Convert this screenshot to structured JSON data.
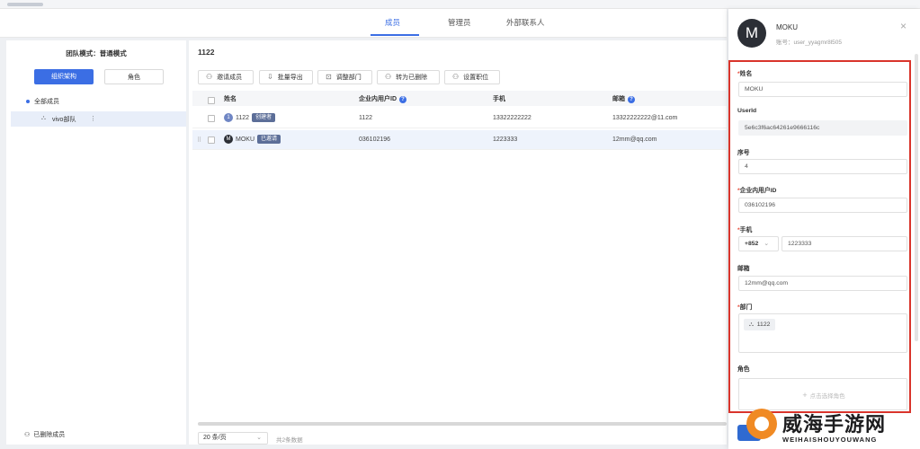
{
  "tabs": [
    "成员",
    "管理员",
    "外部联系人"
  ],
  "left": {
    "title": "团队模式：普通模式",
    "seg_org": "组织架构",
    "seg_role": "角色",
    "all_members": "全部成员",
    "dept": "vivo部队",
    "deleted": "已删除成员"
  },
  "main": {
    "title": "1122",
    "toolbar": {
      "invite": "邀请成员",
      "export": "批量导出",
      "adjust": "调整部门",
      "move": "转为已删除",
      "position": "设置职位"
    },
    "columns": [
      "姓名",
      "企业内用户ID",
      "手机",
      "邮箱"
    ],
    "rows": [
      {
        "avatar": "1",
        "name": "1122",
        "badge": "创建者",
        "uid": "1122",
        "phone": "13322222222",
        "email": "13322222222@11.com"
      },
      {
        "avatar": "M",
        "name": "MOKU",
        "badge": "已邀请",
        "uid": "036102196",
        "phone": "1223333",
        "email": "12mm@qq.com"
      }
    ],
    "pager": "20 条/页",
    "total": "共2条数据"
  },
  "drawer": {
    "avatar": "M",
    "name": "MOKU",
    "account": "账号：user_yyagmr8l505",
    "fields": {
      "name_label": "姓名",
      "name_value": "MOKU",
      "userid_label": "UserId",
      "userid_value": "5e6c3f6ac64261e9666116c",
      "index_label": "序号",
      "index_value": "4",
      "uid_label": "企业内用户ID",
      "uid_value": "036102196",
      "phone_label": "手机",
      "phone_code": "+852",
      "phone_value": "1223333",
      "email_label": "邮箱",
      "email_value": "12mm@qq.com",
      "dept_label": "部门",
      "dept_value": "1122",
      "role_label": "角色",
      "role_add": "点击选择角色"
    }
  },
  "watermark": {
    "text": "威海手游网",
    "sub": "WEIHAISHOUYOUWANG"
  }
}
